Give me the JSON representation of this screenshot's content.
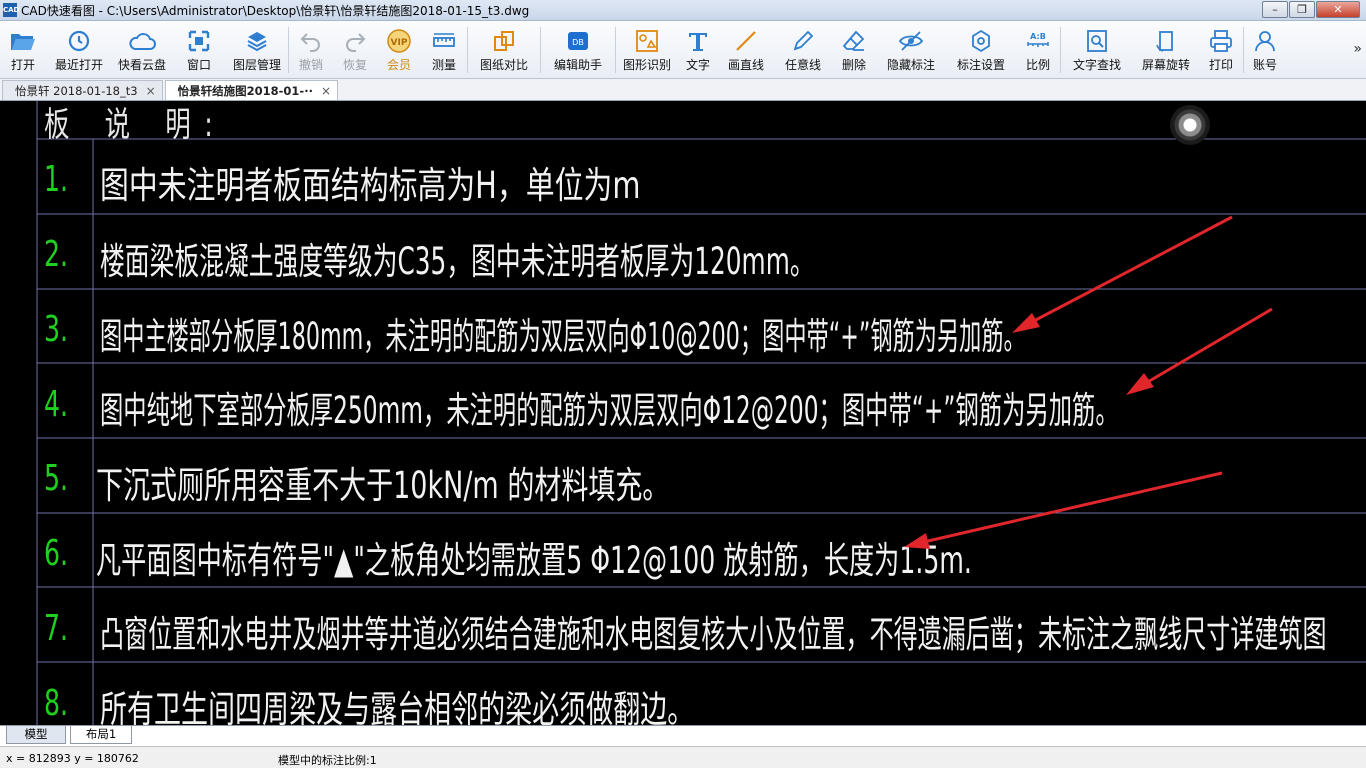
{
  "window": {
    "title": "CAD快速看图 - C:\\Users\\Administrator\\Desktop\\怡景轩\\怡景轩结施图2018-01-15_t3.dwg",
    "app_icon_text": "CAD"
  },
  "toolbar": {
    "items": [
      {
        "label": "打开",
        "icon": "folder-open-icon"
      },
      {
        "label": "最近打开",
        "icon": "recent-clock-icon"
      },
      {
        "label": "快看云盘",
        "icon": "cloud-icon"
      },
      {
        "label": "窗口",
        "icon": "window-frame-icon"
      },
      {
        "label": "图层管理",
        "icon": "layers-icon"
      },
      {
        "label": "撤销",
        "icon": "undo-icon"
      },
      {
        "label": "恢复",
        "icon": "redo-icon"
      },
      {
        "label": "会员",
        "icon": "vip-badge-icon"
      },
      {
        "label": "测量",
        "icon": "ruler-icon"
      },
      {
        "label": "图纸对比",
        "icon": "compare-icon"
      },
      {
        "label": "编辑助手",
        "icon": "edit-assistant-icon"
      },
      {
        "label": "图形识别",
        "icon": "shape-recognition-icon"
      },
      {
        "label": "文字",
        "icon": "text-t-icon"
      },
      {
        "label": "画直线",
        "icon": "line-icon"
      },
      {
        "label": "任意线",
        "icon": "pencil-icon"
      },
      {
        "label": "删除",
        "icon": "eraser-icon"
      },
      {
        "label": "隐藏标注",
        "icon": "eye-hidden-icon"
      },
      {
        "label": "标注设置",
        "icon": "annotation-settings-icon"
      },
      {
        "label": "比例",
        "icon": "ratio-icon"
      },
      {
        "label": "文字查找",
        "icon": "text-search-icon"
      },
      {
        "label": "屏幕旋转",
        "icon": "rotate-screen-icon"
      },
      {
        "label": "打印",
        "icon": "printer-icon"
      },
      {
        "label": "账号",
        "icon": "user-icon"
      }
    ],
    "more": "»"
  },
  "tabs": [
    {
      "label": "怡景轩 2018-01-18_t3",
      "close": "×"
    },
    {
      "label": "怡景轩结施图2018-01-··",
      "close": "×"
    }
  ],
  "drawing": {
    "heading": "板 说 明:",
    "notes": [
      {
        "num": "1.",
        "text": "图中未注明者板面结构标高为H，单位为m"
      },
      {
        "num": "2.",
        "text": "楼面梁板混凝土强度等级为C35，图中未注明者板厚为120mm。"
      },
      {
        "num": "3.",
        "text": "图中主楼部分板厚180mm，未注明的配筋为双层双向Φ10@200；图中带“+”钢筋为另加筋。"
      },
      {
        "num": "4.",
        "text": "图中纯地下室部分板厚250mm，未注明的配筋为双层双向Φ12@200；图中带“+”钢筋为另加筋。"
      },
      {
        "num": "5.",
        "text": "下沉式厕所用容重不大于10kN/m  的材料填充。"
      },
      {
        "num": "6.",
        "text": "凡平面图中标有符号\"▲\"之板角处均需放置5 Φ12@100 放射筋，长度为1.5m."
      },
      {
        "num": "7.",
        "text": "凸窗位置和水电井及烟井等井道必须结合建施和水电图复核大小及位置，不得遗漏后凿；未标注之飘线尺寸详建筑图"
      },
      {
        "num": "8.",
        "text": "所有卫生间四周梁及与露台相邻的梁必须做翻边。"
      }
    ]
  },
  "layout_tabs": [
    "模型",
    "布局1"
  ],
  "status": {
    "coords": "x = 812893  y = 180762",
    "scale": "模型中的标注比例:1"
  },
  "colors": {
    "canvas_bg": "#000000",
    "grid_line": "#6b6fa8",
    "number_green": "#1fd11f",
    "text_white": "#f2f2f2",
    "arrow_red": "#e0262b"
  }
}
